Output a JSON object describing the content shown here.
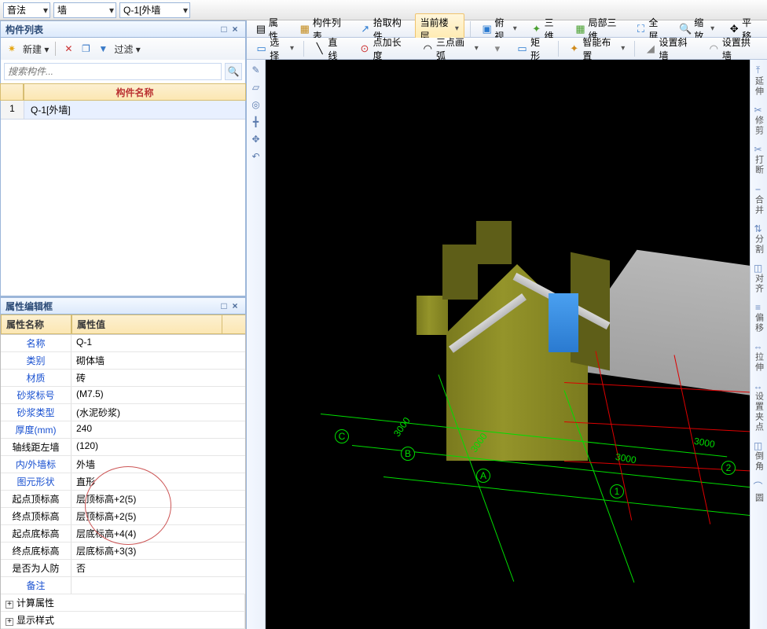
{
  "top_bar": {
    "dd1": "音法",
    "dd2": "墙",
    "dd3": "Q-1[外墙"
  },
  "tab_bar": {
    "t1": "属性",
    "t2": "构件列表",
    "t3": "拾取构件",
    "t4": "当前楼层",
    "t5": "俯视",
    "t6": "三维",
    "t7": "局部三维",
    "t8": "全屏",
    "t9": "缩放",
    "t10": "平移"
  },
  "ribbon": {
    "select": "选择",
    "line": "直线",
    "point_len": "点加长度",
    "arc3": "三点画弧",
    "rect": "矩形",
    "smart": "智能布置",
    "slope": "设置斜墙",
    "arch": "设置拱墙"
  },
  "comp_panel": {
    "title": "构件列表",
    "new": "新建",
    "filter": "过滤",
    "search_ph": "搜索构件...",
    "col": "构件名称",
    "rows": [
      {
        "idx": "1",
        "name": "Q-1[外墙]"
      }
    ]
  },
  "prop_panel": {
    "title": "属性编辑框",
    "head_name": "属性名称",
    "head_val": "属性值",
    "rows": [
      {
        "k": "名称",
        "v": "Q-1",
        "blue": true
      },
      {
        "k": "类别",
        "v": "砌体墙",
        "blue": true
      },
      {
        "k": "材质",
        "v": "砖",
        "blue": true
      },
      {
        "k": "砂浆标号",
        "v": "(M7.5)",
        "blue": true
      },
      {
        "k": "砂浆类型",
        "v": "(水泥砂浆)",
        "blue": true
      },
      {
        "k": "厚度(mm)",
        "v": "240",
        "blue": true
      },
      {
        "k": "轴线距左墙",
        "v": "(120)",
        "blue": false
      },
      {
        "k": "内/外墙标",
        "v": "外墙",
        "blue": true
      },
      {
        "k": "图元形状",
        "v": "直形",
        "blue": true
      },
      {
        "k": "起点顶标高",
        "v": "层顶标高+2(5)",
        "blue": false
      },
      {
        "k": "终点顶标高",
        "v": "层顶标高+2(5)",
        "blue": false
      },
      {
        "k": "起点底标高",
        "v": "层底标高+4(4)",
        "blue": false
      },
      {
        "k": "终点底标高",
        "v": "层底标高+3(3)",
        "blue": false
      },
      {
        "k": "是否为人防",
        "v": "否",
        "blue": false
      },
      {
        "k": "备注",
        "v": "",
        "blue": true
      }
    ],
    "expanders": [
      "计算属性",
      "显示样式"
    ]
  },
  "side_tools": {
    "items": [
      "延伸",
      "修剪",
      "打断",
      "合并",
      "分割",
      "对齐",
      "偏移",
      "拉伸",
      "设置夹点",
      "倒角",
      "圆"
    ]
  },
  "viewport": {
    "axes_letters": [
      "A",
      "B",
      "C"
    ],
    "axes_nums": [
      "1",
      "2"
    ],
    "dims": [
      "3000",
      "3000",
      "3000",
      "3000"
    ]
  }
}
